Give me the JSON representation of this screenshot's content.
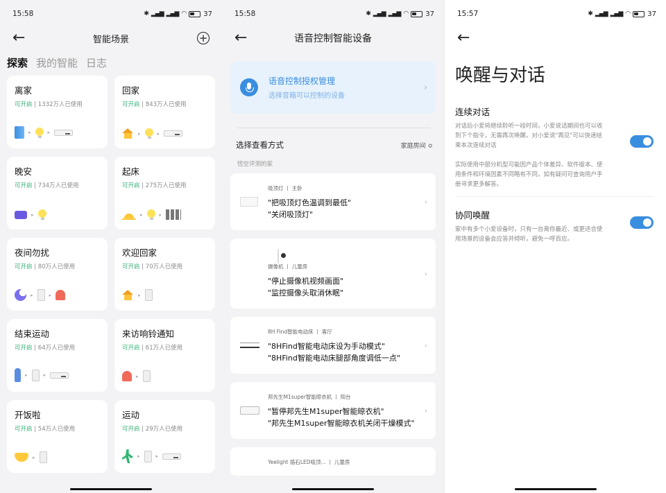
{
  "screen1": {
    "time": "15:58",
    "battery": "37",
    "title": "智能场景",
    "tabs": [
      "探索",
      "我的智能",
      "日志"
    ],
    "cards": [
      {
        "title": "离家",
        "status": "可开启",
        "usage": "1332万人已使用",
        "icons": [
          "door-icon",
          "bulb-icon",
          "ac-icon"
        ]
      },
      {
        "title": "回家",
        "status": "可开启",
        "usage": "843万人已使用",
        "icons": [
          "house-icon",
          "bulb-icon",
          "ac-icon"
        ]
      },
      {
        "title": "晚安",
        "status": "可开启",
        "usage": "734万人已使用",
        "icons": [
          "bed-icon",
          "bulb-icon"
        ]
      },
      {
        "title": "起床",
        "status": "可开启",
        "usage": "275万人已使用",
        "icons": [
          "sunrise-icon",
          "bulb-icon",
          "curtain-icon"
        ]
      },
      {
        "title": "夜间勿扰",
        "status": "可开启",
        "usage": "80万人已使用",
        "icons": [
          "moon-icon",
          "speaker-icon",
          "bell-icon"
        ]
      },
      {
        "title": "欢迎回家",
        "status": "可开启",
        "usage": "70万人已使用",
        "icons": [
          "house-icon",
          "speaker-icon"
        ]
      },
      {
        "title": "结束运动",
        "status": "可开启",
        "usage": "64万人已使用",
        "icons": [
          "person-icon",
          "speaker-icon",
          "ac-icon"
        ]
      },
      {
        "title": "来访响铃通知",
        "status": "可开启",
        "usage": "61万人已使用",
        "icons": [
          "bell-icon",
          "speaker-icon"
        ]
      },
      {
        "title": "开饭啦",
        "status": "可开启",
        "usage": "54万人已使用",
        "icons": [
          "bowl-icon",
          "speaker-icon"
        ]
      },
      {
        "title": "运动",
        "status": "可开启",
        "usage": "29万人已使用",
        "icons": [
          "run-icon",
          "speaker-icon",
          "ac-icon"
        ]
      }
    ]
  },
  "screen2": {
    "time": "15:58",
    "battery": "37",
    "title": "语音控制智能设备",
    "auth_title": "语音控制授权管理",
    "auth_sub": "选择音箱可以控制的设备",
    "section_title": "选择查看方式",
    "section_right": "家庭房间 ≎",
    "section_sub": "悟空评测的家",
    "devices": [
      {
        "meta": "吸顶灯 丨 主卧",
        "cmds": [
          "\"把吸顶灯色温调到最低\"",
          "\"关闭吸顶灯\""
        ],
        "thumb": "lamp"
      },
      {
        "meta": "摄像机 丨 儿童房",
        "cmds": [
          "\"停止摄像机视频画面\"",
          "\"监控摄像头取消休眠\""
        ],
        "thumb": "cam"
      },
      {
        "meta": "8H Find智能电动床  丨 客厅",
        "cmds": [
          "\"8HFind智能电动床设为手动模式\"",
          "\"8HFind智能电动床腿部角度调低一点\""
        ],
        "thumb": "bed"
      },
      {
        "meta": "邦先生M1super智能晾衣机 丨 阳台",
        "cmds": [
          "\"暂停邦先生M1super智能晾衣机\"",
          "\"邦先生M1super智能晾衣机关闭干燥模式\""
        ],
        "thumb": "dryer"
      },
      {
        "meta": "Yeelight 插石LED吸顶... 丨 儿童房",
        "cmds": [],
        "thumb": "none"
      }
    ]
  },
  "screen3": {
    "time": "15:57",
    "battery": "37",
    "title": "唤醒与对话",
    "block1_title": "连续对话",
    "block1_text": "对话后小爱将继续聆听一段时间，小爱说话期间也可以收到下个指令，无需再次唤醒。对小爱说\"再见\"可以快速结束本次连续对话",
    "block1_note": "实际使用中部分机型可能因产品个体差异、软件版本、使用条件和环境因素不同略有不同，如有疑问可查询用户手册寻求更多解答。",
    "block1_on": true,
    "block2_title": "协同唤醒",
    "block2_text": "家中有多个小爱设备时，只有一台离你最近、或更适合使用场景的设备会应答并倾听，避免一呼百应。",
    "block2_on": true
  }
}
